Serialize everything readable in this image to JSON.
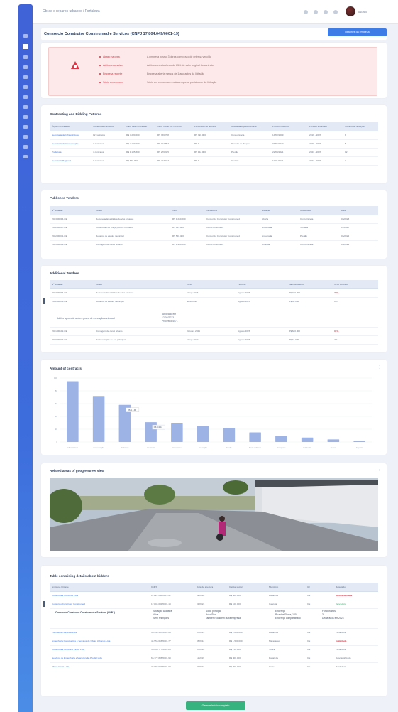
{
  "breadcrumb": "Obras e reparos urbanos / Fortaleza",
  "user": {
    "name": "usuário"
  },
  "page": {
    "title": "Consorcio Construtor Construmed e Servicos (CNPJ 17.804.049/0001-19)"
  },
  "header_button": "Detalhes da empresa",
  "alerts": [
    {
      "label": "Atraso na obra",
      "text": "A empresa possui 3 obras com prazo de entrega vencido"
    },
    {
      "label": "Aditivo excessivo",
      "text": "Aditivo contratual excede 25% do valor original do contrato"
    },
    {
      "label": "Empresa recente",
      "text": "Empresa aberta menos de 1 ano antes da licitação"
    },
    {
      "label": "Sócio em comum",
      "text": "Sócio em comum com outra empresa participante da licitação"
    }
  ],
  "contracting": {
    "title": "Contracting and Bidding Patterns",
    "headers": [
      "Órgão contratante",
      "Número de contratos",
      "Valor total contratado",
      "Valor médio por contrato",
      "Percentual de aditivos",
      "Modalidade predominante",
      "Primeiro contrato",
      "Período analisado",
      "Número de licitações"
    ],
    "rows": [
      [
        "Secretaria de Infraestrutura",
        "12 contratos",
        "R$ 4.280.500",
        "R$ 356.708",
        "R$ 390.000",
        "Concorrência",
        "14/02/2019",
        "2019 - 2023",
        "8"
      ],
      [
        "Secretaria de Conservação",
        "7 contratos",
        "R$ 2.190.000",
        "R$ 312.857",
        "R$ 0",
        "Tomada de Preços",
        "03/05/2020",
        "2020 - 2023",
        "5"
      ],
      [
        "Prefeitura",
        "4 contratos",
        "R$ 1.105.300",
        "R$ 276.325",
        "R$ 122.000",
        "Pregão",
        "22/09/2021",
        "2021 - 2023",
        "12"
      ],
      [
        "Secretaria Regional",
        "3 contratos",
        "R$ 640.000",
        "R$ 213.333",
        "R$ 0",
        "Convite",
        "11/01/2022",
        "2022 - 2023",
        "3"
      ]
    ]
  },
  "published": {
    "title": "Published Tenders",
    "headers": [
      "Nº licitação",
      "Objeto",
      "Valor",
      "Vencedora",
      "Situação",
      "Modalidade",
      "Data"
    ],
    "rows": [
      [
        "2023/00014-CE",
        "Recuperação asfáltica de vias urbanas",
        "R$ 1.210.000",
        "Consorcio Construtor Construmed",
        "Aberta",
        "Concorrência",
        "03/2023"
      ],
      [
        "2022/00087-CE",
        "Construção de praça pública no bairro",
        "R$ 845.000",
        "Outra construtora",
        "Encerrada",
        "Tomada",
        "11/2022"
      ],
      [
        "2022/00041-CE",
        "Reforma de escola municipal",
        "R$ 520.400",
        "Consorcio Construtor Construmed",
        "Encerrada",
        "Pregão",
        "06/2022"
      ],
      [
        "2021/00102-CE",
        "Drenagem de canal urbano",
        "R$ 1.980.000",
        "Outra construtora",
        "Anulada",
        "Concorrência",
        "09/2021"
      ]
    ]
  },
  "additional": {
    "title": "Additional Tenders",
    "headers": [
      "Nº licitação",
      "Objeto",
      "Início",
      "Término",
      "Valor do aditivo",
      "% do contrato"
    ],
    "rows": [
      [
        "2023/00014-CE",
        "Recuperação asfáltica de vias urbanas",
        "Março 2023",
        "Agosto 2023",
        "R$ 310.000",
        "26%"
      ],
      [
        "2022/00041-CE",
        "Reforma de escola municipal",
        "Julho 2022",
        "Agosto 2023",
        "R$ 45.000",
        "9%"
      ],
      [
        "2021/00102-CE",
        "Drenagem de canal urbano",
        "Outubro 2021",
        "Agosto 2023",
        "R$ 620.000",
        "31%"
      ],
      [
        "2020/00077-CE",
        "Pavimentação de rua principal",
        "Março 2020",
        "Agosto 2023",
        "R$ 18.000",
        "4%"
      ]
    ],
    "note": "Aditivo aprovado após o prazo de execução contratual",
    "note_side": [
      "Aprovado em",
      "12/08/2023",
      "Processo 4471"
    ]
  },
  "chart": {
    "title": "Amount of contracts"
  },
  "chart_data": {
    "type": "bar",
    "title": "Amount of contracts",
    "categories": [
      "Infraestrutura",
      "Conservação",
      "Prefeitura",
      "Regional",
      "Urbanismo",
      "Educação",
      "Saúde",
      "Meio ambiente",
      "Transporte",
      "Habitação",
      "Cultura",
      "Esporte"
    ],
    "values": [
      95,
      72,
      58,
      31,
      30,
      25,
      22,
      15,
      10,
      7,
      4,
      2
    ],
    "ylim": [
      0,
      100
    ],
    "annotations": [
      {
        "category": "Prefeitura",
        "text": "R$ 1.1M"
      },
      {
        "category": "Regional",
        "text": "R$ 640k"
      }
    ],
    "color": "#9db3e6"
  },
  "street": {
    "title": "Related areas of google street view"
  },
  "tables_detail": {
    "title": "Table containing details about bidders",
    "headers": [
      "Empresa licitante",
      "CNPJ",
      "Data de abertura",
      "Capital social",
      "Município",
      "UF",
      "Resultado"
    ],
    "rows": [
      [
        "Construtora Horizonte Ltda",
        "11.222.333/0001-44",
        "02/2018",
        "R$ 500.000",
        "Fortaleza",
        "CE",
        "Desclassificada"
      ],
      [
        "Consorcio Construtor Construmed",
        "17.804.049/0001-19",
        "01/2023",
        "R$ 100.000",
        "Caucaia",
        "CE",
        "Vencedora"
      ]
    ],
    "detail": {
      "company": "Consorcio Construtor Construmed e Servicos (CNPJ)",
      "col1": [
        "Situação cadastral",
        "Ativa",
        "Sem restrições"
      ],
      "col2": [
        "Sócio principal",
        "João Silva",
        "Também sócio em outra empresa"
      ],
      "col3": [
        "Endereço",
        "Rua das Flores, 120",
        "Endereço compartilhado"
      ],
      "col4": [
        "Funcionários",
        "3",
        "Declarados em 2023"
      ]
    },
    "more_rows": [
      [
        "Pavimenta Nordeste Ltda",
        "33.444.555/0001-66",
        "05/2015",
        "R$ 2.000.000",
        "Fortaleza",
        "CE",
        "Perdedora"
      ],
      [
        "Engenharia Construções e Serviços de Obras Urbanas Ltda",
        "44.555.666/0001-77",
        "08/2012",
        "R$ 1.500.000",
        "Maracanaú",
        "CE",
        "Inabilitada"
      ],
      [
        "Construtora Oliveira e Filhos Ltda",
        "55.666.777/0001-88",
        "03/2010",
        "R$ 750.000",
        "Sobral",
        "CE",
        "Perdedora"
      ],
      [
        "Serviços de Engenharia e Manutenção Predial Ltda",
        "66.777.888/0001-99",
        "11/2019",
        "R$ 300.000",
        "Fortaleza",
        "CE",
        "Desclassificada"
      ],
      [
        "Obras Costa Ltda",
        "77.888.999/0001-00",
        "07/2016",
        "R$ 900.000",
        "Crato",
        "CE",
        "Perdedora"
      ]
    ]
  },
  "footer_button": "Gerar relatório completo"
}
